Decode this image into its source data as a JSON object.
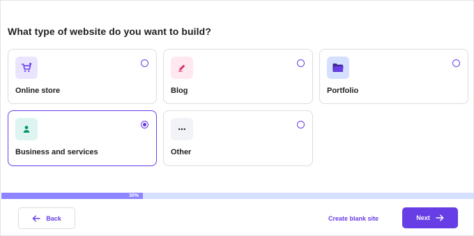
{
  "heading": "What type of website do you want to build?",
  "options": [
    {
      "label": "Online store",
      "icon": "shopping-cart-icon",
      "icon_bg": "#ebe4ff",
      "icon_color": "#673de6",
      "selected": false
    },
    {
      "label": "Blog",
      "icon": "pen-icon",
      "icon_bg": "#ffe8ef",
      "icon_color": "#d63163",
      "selected": false
    },
    {
      "label": "Portfolio",
      "icon": "folder-icon",
      "icon_bg": "#d5dfff",
      "icon_color": "#3b2a8f",
      "selected": false
    },
    {
      "label": "Business and services",
      "icon": "person-icon",
      "icon_bg": "#def4f0",
      "icon_color": "#00b090",
      "selected": true
    },
    {
      "label": "Other",
      "icon": "more-dots-icon",
      "icon_bg": "#f2f3f6",
      "icon_color": "#1d1e20",
      "selected": false
    }
  ],
  "progress": {
    "value": 30,
    "label": "30%"
  },
  "footer": {
    "back_label": "Back",
    "create_blank_label": "Create blank site",
    "next_label": "Next"
  },
  "colors": {
    "accent": "#673de6",
    "progress_track": "#d5dfff",
    "progress_fill": "#8c85ff",
    "border": "#dadce0"
  }
}
